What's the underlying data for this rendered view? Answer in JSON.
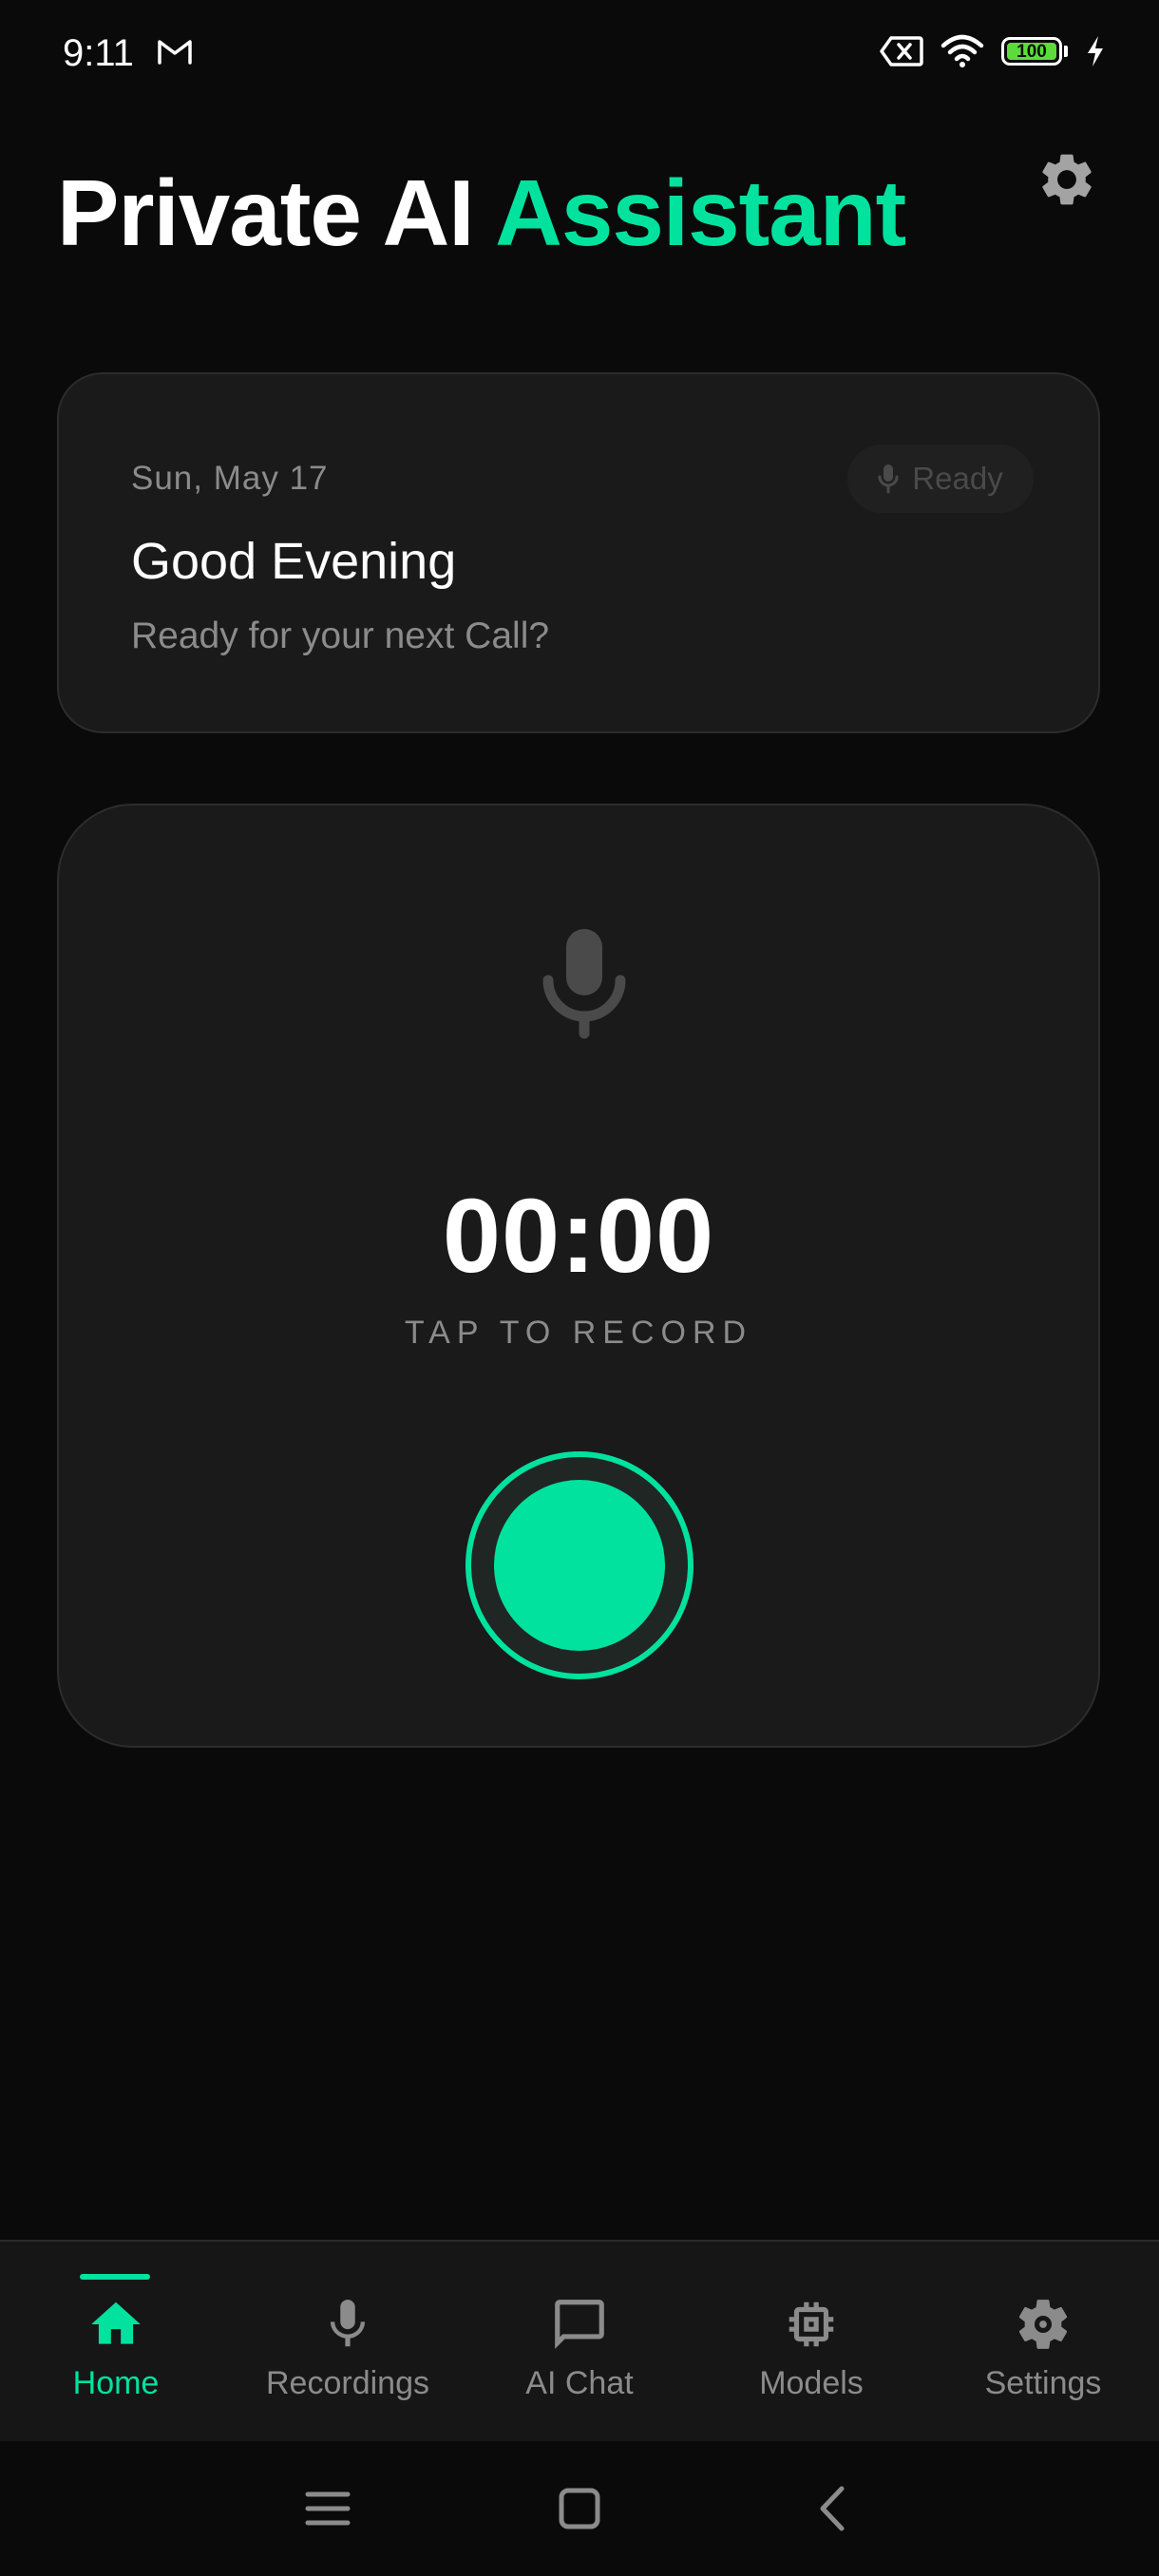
{
  "status_bar": {
    "time": "9:11",
    "battery_level": "100",
    "icons": [
      "gmail-icon",
      "no-sim-icon",
      "wifi-icon",
      "battery-icon",
      "charging-icon"
    ]
  },
  "header": {
    "title_part1": "Private AI",
    "title_part2": "Assistant",
    "settings_icon": "gear-icon"
  },
  "greeting_card": {
    "date": "Sun, May 17",
    "badge_label": "Ready",
    "title": "Good Evening",
    "subtitle": "Ready for your next Call?"
  },
  "record_card": {
    "mic_icon": "microphone-icon",
    "timer": "00:00",
    "hint": "TAP TO RECORD",
    "record_button": "record-button"
  },
  "bottom_nav": {
    "active": "Home",
    "items": [
      {
        "label": "Home",
        "icon": "home-icon"
      },
      {
        "label": "Recordings",
        "icon": "microphone-icon"
      },
      {
        "label": "AI Chat",
        "icon": "chat-bubble-icon"
      },
      {
        "label": "Models",
        "icon": "chip-icon"
      },
      {
        "label": "Settings",
        "icon": "gear-icon"
      }
    ]
  },
  "system_nav": [
    "menu-icon",
    "home-square-icon",
    "back-icon"
  ],
  "colors": {
    "accent": "#00e29e",
    "background": "#0a0a0a",
    "card": "#1a1a1a",
    "muted_text": "#8b8b8b"
  }
}
